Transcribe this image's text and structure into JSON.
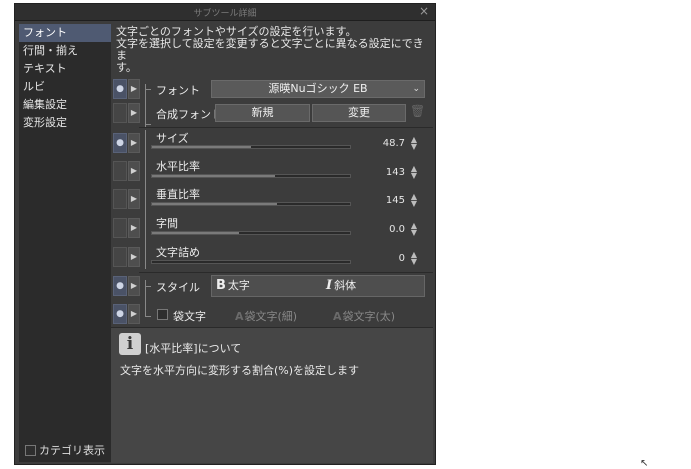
{
  "window": {
    "title": "サブツール詳細",
    "close_glyph": "×"
  },
  "sidebar": {
    "items": [
      {
        "label": "フォント",
        "active": true
      },
      {
        "label": "行間・揃え"
      },
      {
        "label": "テキスト"
      },
      {
        "label": "ルビ"
      },
      {
        "label": "編集設定"
      },
      {
        "label": "変形設定"
      }
    ],
    "category_display": "カテゴリ表示"
  },
  "description": {
    "line1": "文字ごとのフォントやサイズの設定を行います。",
    "line2": "文字を選択して設定を変更すると文字ごとに異なる設定にできま",
    "line3": "す。"
  },
  "properties": {
    "font": {
      "label": "フォント",
      "value": "源暎Nuゴシック EB"
    },
    "composite_font": {
      "label": "合成フォント",
      "new_label": "新規",
      "change_label": "変更"
    },
    "size": {
      "label": "サイズ",
      "value": "48.7",
      "fill": 0.5
    },
    "hscale": {
      "label": "水平比率",
      "value": "143",
      "fill": 0.62
    },
    "vscale": {
      "label": "垂直比率",
      "value": "145",
      "fill": 0.63
    },
    "spacing": {
      "label": "字間",
      "value": "0.0",
      "fill": 0.44
    },
    "tracking": {
      "label": "文字詰め",
      "value": "0",
      "fill": 0.0
    },
    "style": {
      "label": "スタイル",
      "bold_label": "太字",
      "italic_label": "斜体"
    },
    "outline": {
      "label": "袋文字",
      "thin_label": "袋文字(細)",
      "thick_label": "袋文字(太)"
    }
  },
  "help": {
    "title": "[水平比率]について",
    "body": "文字を水平方向に変形する割合(%)を設定します"
  },
  "icons": {
    "eye": "eye-icon",
    "expand": "triangle-right-icon",
    "dropdown": "chevron-down-icon",
    "trash": "trash-icon",
    "info": "info-icon",
    "bold": "bold-icon",
    "italic": "italic-icon"
  },
  "colors": {
    "active_item": "#4f5a72",
    "panel": "#3c3c3c",
    "sidebar": "#2b2b2b"
  }
}
